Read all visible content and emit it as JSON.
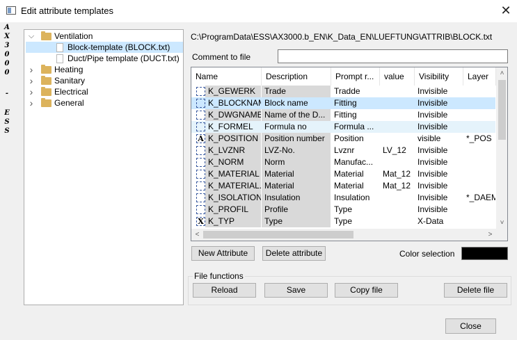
{
  "window": {
    "title": "Edit attribute templates",
    "brand_letters": [
      "A",
      "X",
      "3",
      "0",
      "0",
      "0",
      "-",
      "E",
      "S",
      "S"
    ]
  },
  "tree": {
    "items": [
      {
        "label": "Ventilation",
        "type": "folder",
        "expanded": true
      },
      {
        "label": "Block-template (BLOCK.txt)",
        "type": "file",
        "selected": true
      },
      {
        "label": "Duct/Pipe template (DUCT.txt)",
        "type": "file"
      },
      {
        "label": "Heating",
        "type": "folder",
        "expanded": false
      },
      {
        "label": "Sanitary",
        "type": "folder",
        "expanded": false
      },
      {
        "label": "Electrical",
        "type": "folder",
        "expanded": false
      },
      {
        "label": "General",
        "type": "folder",
        "expanded": false
      }
    ]
  },
  "path": "C:\\ProgramData\\ESS\\AX3000.b_EN\\K_Data_EN\\LUEFTUNG\\ATTRIB\\BLOCK.txt",
  "comment": {
    "label": "Comment to file",
    "value": ""
  },
  "grid": {
    "columns": [
      "Name",
      "Description",
      "Prompt r...",
      "value",
      "Visibility",
      "Layer"
    ],
    "rows": [
      {
        "icon": "",
        "name": "K_GEWERK",
        "description": "Trade",
        "prompt": "Tradde",
        "value": "",
        "visibility": "Invisible",
        "layer": ""
      },
      {
        "icon": "",
        "name": "K_BLOCKNAME",
        "description": "Block name",
        "prompt": "Fitting",
        "value": "",
        "visibility": "Invisible",
        "layer": "",
        "state": "selected"
      },
      {
        "icon": "",
        "name": "K_DWGNAME",
        "description": "Name of the D...",
        "prompt": "Fitting",
        "value": "",
        "visibility": "Invisible",
        "layer": ""
      },
      {
        "icon": "",
        "name": "K_FORMEL",
        "description": "Formula no",
        "prompt": "Formula ...",
        "value": "",
        "visibility": "Invisible",
        "layer": "",
        "state": "hover"
      },
      {
        "icon": "A",
        "name": "K_POSITION",
        "description": "Position number",
        "prompt": "Position",
        "value": "",
        "visibility": "visible",
        "layer": "*_POS"
      },
      {
        "icon": "",
        "name": "K_LVZNR",
        "description": "LVZ-No.",
        "prompt": "Lvznr",
        "value": "LV_12",
        "visibility": "Invisible",
        "layer": ""
      },
      {
        "icon": "",
        "name": "K_NORM",
        "description": "Norm",
        "prompt": "Manufac...",
        "value": "",
        "visibility": "Invisible",
        "layer": ""
      },
      {
        "icon": "",
        "name": "K_MATERIAL",
        "description": "Material",
        "prompt": "Material",
        "value": "Mat_12",
        "visibility": "Invisible",
        "layer": ""
      },
      {
        "icon": "",
        "name": "K_MATERIAL...",
        "description": "Material",
        "prompt": "Material",
        "value": "Mat_12",
        "visibility": "Invisible",
        "layer": ""
      },
      {
        "icon": "",
        "name": "K_ISOLATION",
        "description": "Insulation",
        "prompt": "Insulation",
        "value": "",
        "visibility": "Invisible",
        "layer": "*_DAEM"
      },
      {
        "icon": "",
        "name": "K_PROFIL",
        "description": "Profile",
        "prompt": "Type",
        "value": "",
        "visibility": "Invisible",
        "layer": ""
      },
      {
        "icon": "X",
        "name": "K_TYP",
        "description": "Type",
        "prompt": "Type",
        "value": "",
        "visibility": "X-Data",
        "layer": ""
      }
    ],
    "scroll_up": "˄",
    "scroll_down": "˅",
    "scroll_left": "<",
    "scroll_right": ">"
  },
  "buttons": {
    "new_attribute": "New Attribute",
    "delete_attribute": "Delete attribute",
    "color_selection_label": "Color selection",
    "color_value": "#000000"
  },
  "file_functions": {
    "label": "File functions",
    "reload": "Reload",
    "save": "Save",
    "copy_file": "Copy file",
    "delete_file": "Delete file"
  },
  "close": "Close",
  "close_glyph": "✕",
  "colors": {
    "selection": "#cce8ff",
    "hover": "#e5f3fb",
    "folder": "#dcb35c"
  }
}
